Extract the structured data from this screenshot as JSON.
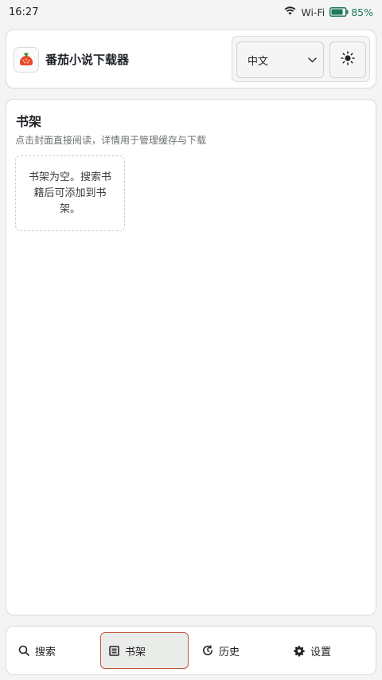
{
  "status_bar": {
    "time": "16:27",
    "wifi_label": "Wi-Fi",
    "battery_percent": "85%",
    "battery_level": 0.85,
    "battery_color": "#1f7a5c"
  },
  "header": {
    "title": "番茄小说下载器",
    "logo_icon": "tomato-icon",
    "language": {
      "selected": "中文",
      "icon": "chevron-down-icon"
    },
    "theme_icon": "sun-icon"
  },
  "bookshelf": {
    "title": "书架",
    "subtitle": "点击封面直接阅读，详情用于管理缓存与下载",
    "empty_message": "书架为空。搜索书籍后可添加到书架。"
  },
  "nav": {
    "items": [
      {
        "label": "搜索",
        "icon": "search-icon"
      },
      {
        "label": "书架",
        "icon": "bookshelf-icon",
        "active": true
      },
      {
        "label": "历史",
        "icon": "history-icon"
      },
      {
        "label": "设置",
        "icon": "gear-icon"
      }
    ],
    "active_border_color": "#c0563a"
  }
}
